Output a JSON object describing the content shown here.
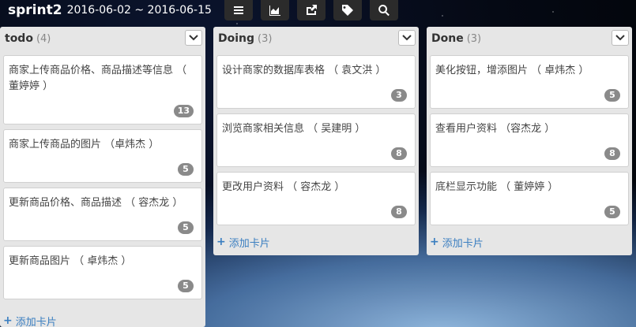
{
  "board": {
    "title": "sprint2",
    "dates": "2016-06-02 ~ 2016-06-15"
  },
  "toolbar": {
    "buttons": [
      {
        "icon": "menu-icon"
      },
      {
        "icon": "chart-icon"
      },
      {
        "icon": "share-icon"
      },
      {
        "icon": "tag-icon"
      },
      {
        "icon": "search-icon"
      }
    ]
  },
  "lists": [
    {
      "name": "todo",
      "count": "(4)",
      "add_label": "添加卡片",
      "cards": [
        {
          "text": "商家上传商品价格、商品描述等信息 （ 董婷婷 ）",
          "points": "13"
        },
        {
          "text": "商家上传商品的图片 （卓炜杰 ）",
          "points": "5"
        },
        {
          "text": "更新商品价格、商品描述 （ 容杰龙 ）",
          "points": "5"
        },
        {
          "text": "更新商品图片 （ 卓炜杰 ）",
          "points": "5"
        }
      ]
    },
    {
      "name": "Doing",
      "count": "(3)",
      "add_label": "添加卡片",
      "cards": [
        {
          "text": "设计商家的数据库表格 （ 袁文洪 ）",
          "points": "3"
        },
        {
          "text": "浏览商家相关信息 （ 吴建明 ）",
          "points": "8"
        },
        {
          "text": "更改用户资料 （ 容杰龙 ）",
          "points": "8"
        }
      ]
    },
    {
      "name": "Done",
      "count": "(3)",
      "add_label": "添加卡片",
      "cards": [
        {
          "text": "美化按钮，增添图片 （ 卓炜杰 ）",
          "points": "5"
        },
        {
          "text": "查看用户资料 （容杰龙 ）",
          "points": "8"
        },
        {
          "text": "底栏显示功能 （ 董婷婷 ）",
          "points": "5"
        }
      ]
    }
  ]
}
